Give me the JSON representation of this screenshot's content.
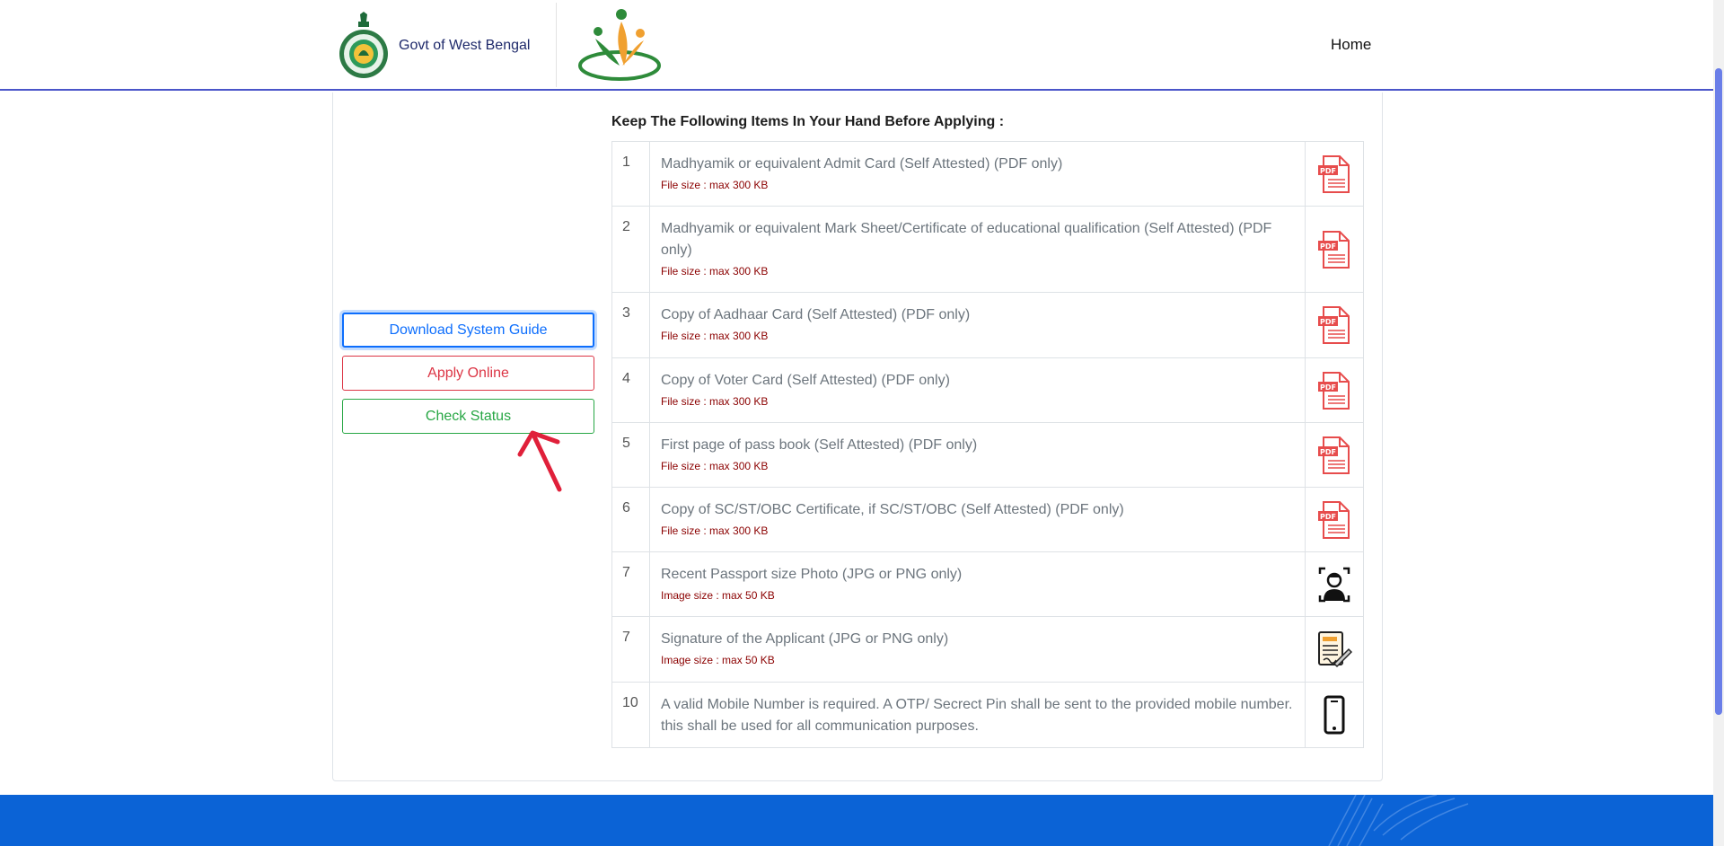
{
  "header": {
    "brand_name": "Govt of West Bengal",
    "nav_home": "Home"
  },
  "sidebar": {
    "download_guide": "Download System Guide",
    "apply_online": "Apply Online",
    "check_status": "Check Status"
  },
  "requirements": {
    "title": "Keep The Following Items In Your Hand Before Applying :",
    "rows": [
      {
        "num": "1",
        "desc": "Madhyamik or equivalent Admit Card (Self Attested) (PDF only)",
        "size": "File size : max 300 KB",
        "icon": "pdf-icon"
      },
      {
        "num": "2",
        "desc": "Madhyamik or equivalent Mark Sheet/Certificate of educational qualification (Self Attested) (PDF only)",
        "size": "File size : max 300 KB",
        "icon": "pdf-icon"
      },
      {
        "num": "3",
        "desc": "Copy of Aadhaar Card (Self Attested) (PDF only)",
        "size": "File size : max 300 KB",
        "icon": "pdf-icon"
      },
      {
        "num": "4",
        "desc": "Copy of Voter Card (Self Attested) (PDF only)",
        "size": "File size : max 300 KB",
        "icon": "pdf-icon"
      },
      {
        "num": "5",
        "desc": "First page of pass book (Self Attested) (PDF only)",
        "size": "File size : max 300 KB",
        "icon": "pdf-icon"
      },
      {
        "num": "6",
        "desc": "Copy of SC/ST/OBC Certificate, if SC/ST/OBC (Self Attested) (PDF only)",
        "size": "File size : max 300 KB",
        "icon": "pdf-icon"
      },
      {
        "num": "7",
        "desc": "Recent Passport size Photo (JPG or PNG only)",
        "size": "Image size : max 50 KB",
        "icon": "face-scan-icon"
      },
      {
        "num": "7",
        "desc": "Signature of the Applicant (JPG or PNG only)",
        "size": "Image size : max 50 KB",
        "icon": "signature-icon"
      },
      {
        "num": "10",
        "desc": "A valid Mobile Number is required. A OTP/ Secrect Pin shall be sent to the provided mobile number. this shall be used for all communication purposes.",
        "size": "",
        "icon": "mobile-phone-icon"
      }
    ]
  },
  "colors": {
    "header_line": "#4a55c9",
    "footer": "#0b63d6",
    "guide_btn": "#0d6efd",
    "apply_btn": "#dc3545",
    "status_btn": "#28a745",
    "size_text": "#8b0000"
  }
}
